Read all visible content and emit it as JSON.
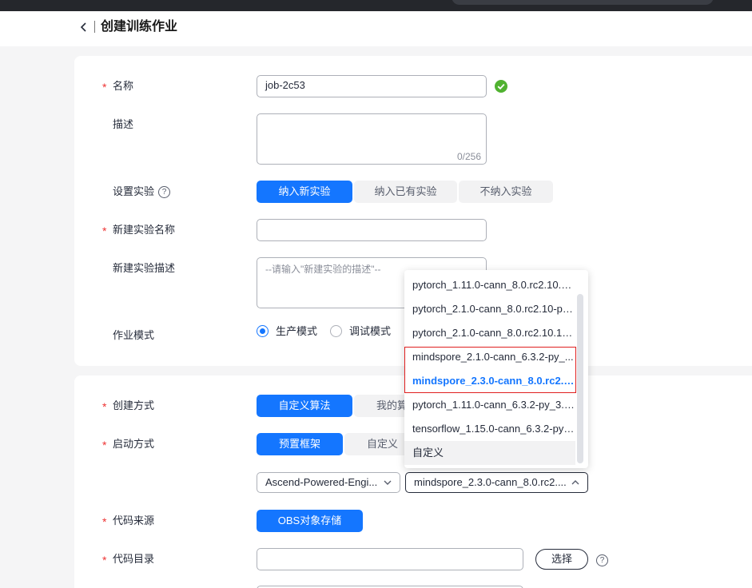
{
  "header": {
    "title": "创建训练作业"
  },
  "form": {
    "name": {
      "label": "名称",
      "value": "job-2c53"
    },
    "description": {
      "label": "描述",
      "counter": "0/256"
    },
    "experiment": {
      "label": "设置实验",
      "options": [
        "纳入新实验",
        "纳入已有实验",
        "不纳入实验"
      ],
      "selected": "纳入新实验"
    },
    "new_experiment_name": {
      "label": "新建实验名称",
      "value": ""
    },
    "new_experiment_desc": {
      "label": "新建实验描述",
      "placeholder": "--请输入\"新建实验的描述\"--"
    },
    "job_mode": {
      "label": "作业模式",
      "options": [
        "生产模式",
        "调试模式"
      ],
      "selected": "生产模式"
    },
    "create_method": {
      "label": "创建方式",
      "options": [
        "自定义算法",
        "我的算"
      ],
      "selected": "自定义算法"
    },
    "boot_method": {
      "label": "启动方式",
      "options": [
        "预置框架",
        "自定义"
      ],
      "selected": "预置框架"
    },
    "engine_select": {
      "value": "Ascend-Powered-Engi..."
    },
    "version_select": {
      "value": "mindspore_2.3.0-cann_8.0.rc2...."
    },
    "code_source": {
      "label": "代码来源",
      "button": "OBS对象存储"
    },
    "code_dir": {
      "label": "代码目录",
      "button": "选择"
    }
  },
  "dropdown": {
    "items": [
      "pytorch_1.11.0-cann_8.0.rc2.10.1...",
      "pytorch_2.1.0-cann_8.0.rc2.10-py...",
      "pytorch_2.1.0-cann_8.0.rc2.10.16...",
      "mindspore_2.1.0-cann_6.3.2-py_...",
      "mindspore_2.3.0-cann_8.0.rc2.1...",
      "pytorch_1.11.0-cann_6.3.2-py_3.7...",
      "tensorflow_1.15.0-cann_6.3.2-py_...",
      "自定义"
    ],
    "selected_index": 4
  },
  "colors": {
    "accent": "#1476ff",
    "required": "#ee3333",
    "success": "#50b230",
    "highlight_box": "#e02020"
  }
}
